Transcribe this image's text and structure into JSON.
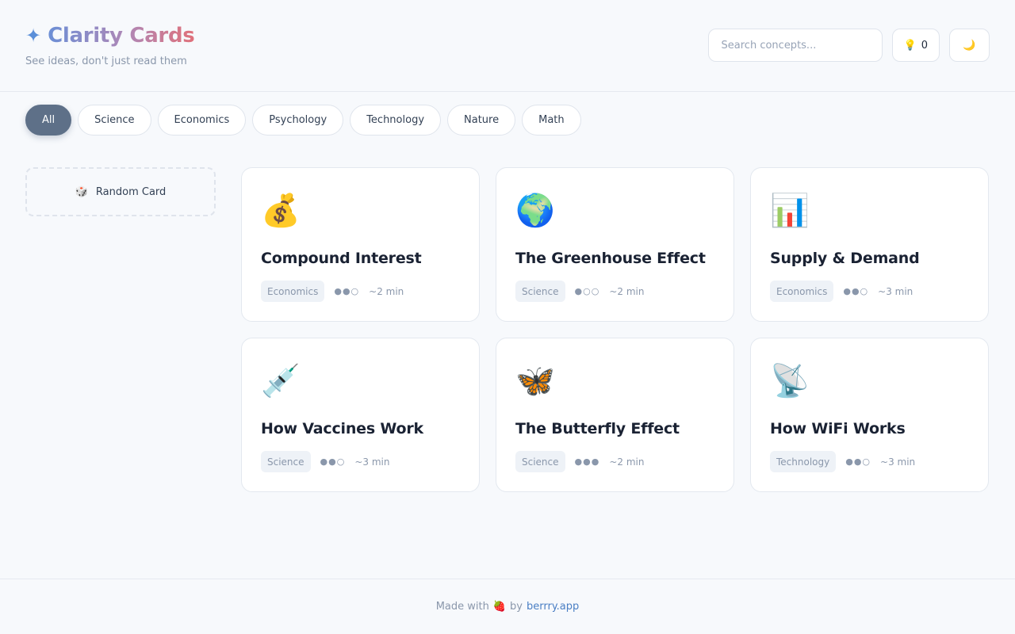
{
  "header": {
    "sparkle": "✦",
    "title": "Clarity Cards",
    "tagline": "See ideas, don't just read them",
    "search_placeholder": "Search concepts...",
    "ideas_icon": "💡",
    "ideas_count": "0",
    "theme_icon": "🌙"
  },
  "filters": [
    {
      "label": "All",
      "active": true
    },
    {
      "label": "Science"
    },
    {
      "label": "Economics"
    },
    {
      "label": "Psychology"
    },
    {
      "label": "Technology"
    },
    {
      "label": "Nature"
    },
    {
      "label": "Math"
    }
  ],
  "sidebar": {
    "random_icon": "🎲",
    "random_label": "Random Card"
  },
  "cards": [
    {
      "emoji": "💰",
      "title": "Compound Interest",
      "category": "Economics",
      "difficulty": "●●○",
      "time": "~2 min"
    },
    {
      "emoji": "🌍",
      "title": "The Greenhouse Effect",
      "category": "Science",
      "difficulty": "●○○",
      "time": "~2 min"
    },
    {
      "emoji": "📊",
      "title": "Supply & Demand",
      "category": "Economics",
      "difficulty": "●●○",
      "time": "~3 min"
    },
    {
      "emoji": "💉",
      "title": "How Vaccines Work",
      "category": "Science",
      "difficulty": "●●○",
      "time": "~3 min"
    },
    {
      "emoji": "🦋",
      "title": "The Butterfly Effect",
      "category": "Science",
      "difficulty": "●●●",
      "time": "~2 min"
    },
    {
      "emoji": "📡",
      "title": "How WiFi Works",
      "category": "Technology",
      "difficulty": "●●○",
      "time": "~3 min"
    }
  ],
  "footer": {
    "made_with": "Made with",
    "heart_icon": "🍓",
    "by": "by",
    "link": "berrry.app"
  },
  "colors": {
    "accent": "#5e7088",
    "link": "#4a7fc4",
    "muted": "#8a97ab"
  }
}
